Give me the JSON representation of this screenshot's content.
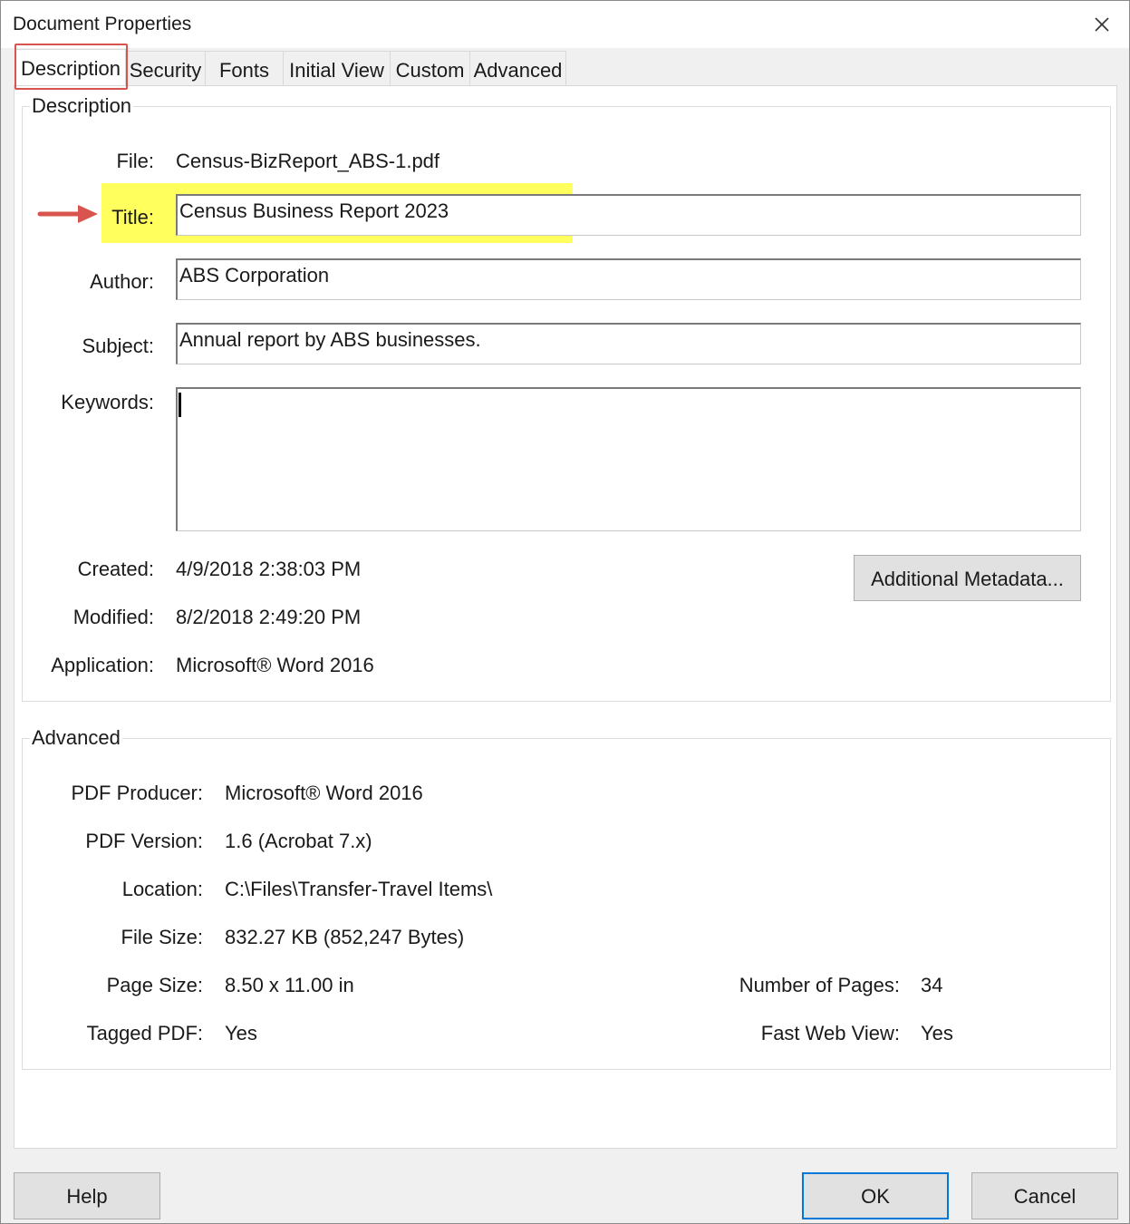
{
  "window": {
    "title": "Document Properties"
  },
  "tabs": [
    {
      "label": "Description",
      "active": true
    },
    {
      "label": "Security"
    },
    {
      "label": "Fonts"
    },
    {
      "label": "Initial View"
    },
    {
      "label": "Custom"
    },
    {
      "label": "Advanced"
    }
  ],
  "description": {
    "legend": "Description",
    "file_label": "File:",
    "file_value": "Census-BizReport_ABS-1.pdf",
    "title_label": "Title:",
    "title_value": "Census Business Report 2023",
    "author_label": "Author:",
    "author_value": "ABS Corporation",
    "subject_label": "Subject:",
    "subject_value": "Annual report by ABS businesses.",
    "keywords_label": "Keywords:",
    "keywords_value": "",
    "created_label": "Created:",
    "created_value": "4/9/2018 2:38:03 PM",
    "modified_label": "Modified:",
    "modified_value": "8/2/2018 2:49:20 PM",
    "application_label": "Application:",
    "application_value": "Microsoft® Word 2016",
    "additional_metadata_label": "Additional Metadata..."
  },
  "advanced": {
    "legend": "Advanced",
    "producer_label": "PDF Producer:",
    "producer_value": "Microsoft® Word 2016",
    "version_label": "PDF Version:",
    "version_value": "1.6 (Acrobat 7.x)",
    "location_label": "Location:",
    "location_value": "C:\\Files\\Transfer-Travel Items\\",
    "filesize_label": "File Size:",
    "filesize_value": "832.27 KB (852,247 Bytes)",
    "pagesize_label": "Page Size:",
    "pagesize_value": "8.50 x 11.00 in",
    "numpages_label": "Number of Pages:",
    "numpages_value": "34",
    "tagged_label": "Tagged PDF:",
    "tagged_value": "Yes",
    "fastweb_label": "Fast Web View:",
    "fastweb_value": "Yes"
  },
  "buttons": {
    "help": "Help",
    "ok": "OK",
    "cancel": "Cancel"
  },
  "colors": {
    "highlight": "#ffff55",
    "annotation_red": "#d9534f",
    "accent": "#0078d7"
  }
}
